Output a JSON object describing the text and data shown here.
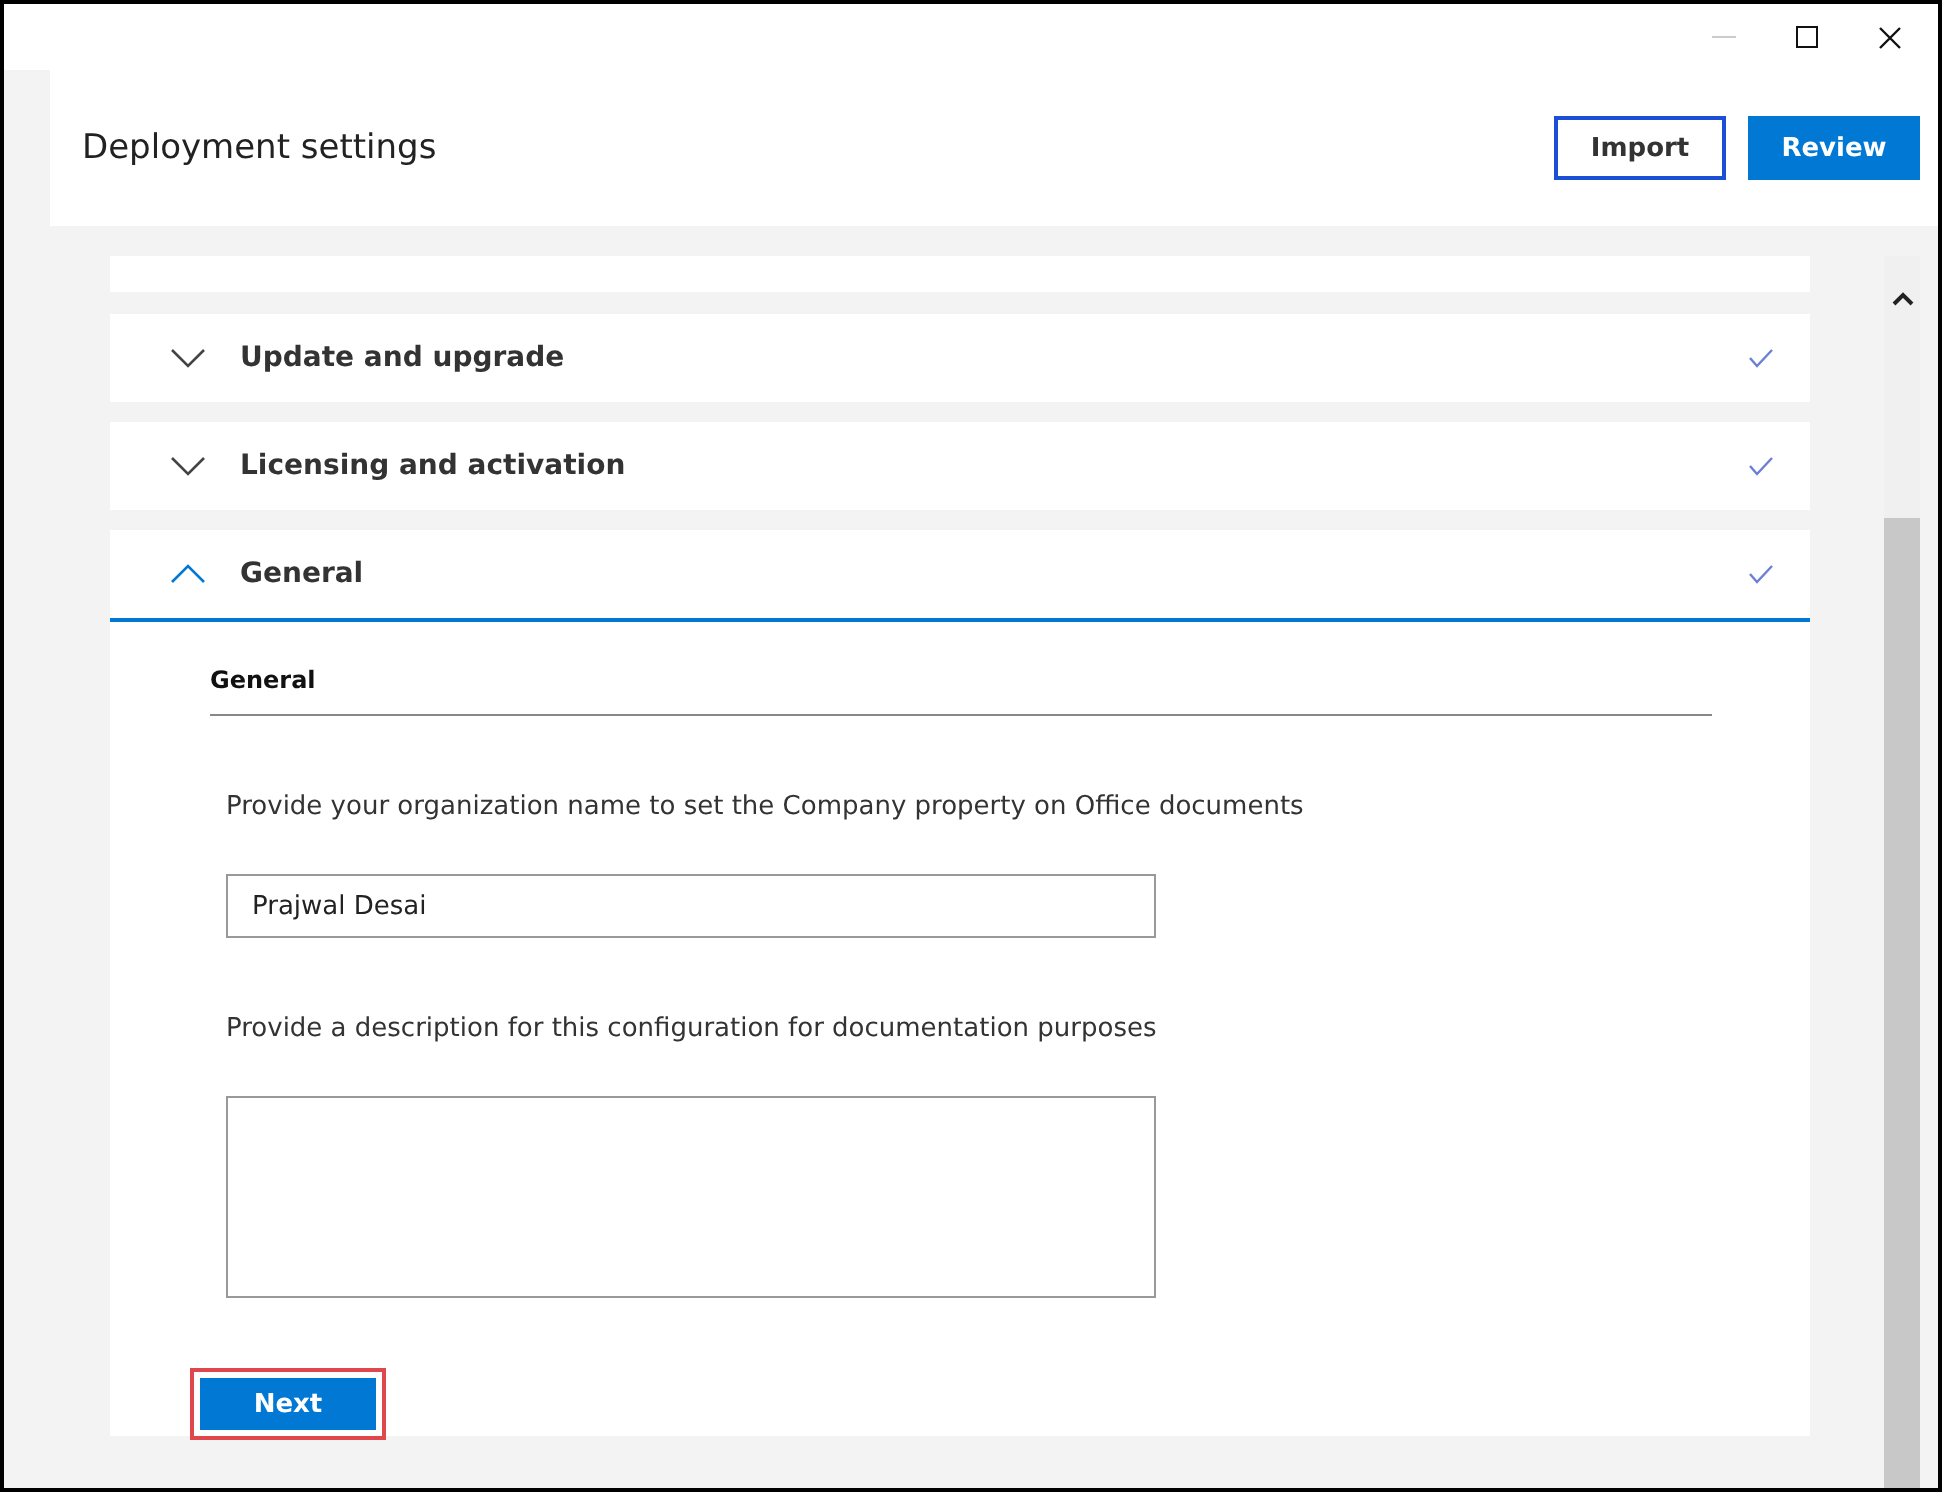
{
  "header": {
    "title": "Deployment settings",
    "buttons": [
      {
        "label": "Import",
        "kind": "secondary"
      },
      {
        "label": "Review",
        "kind": "primary"
      }
    ]
  },
  "sections": [
    {
      "title": "Update and upgrade",
      "expanded": false,
      "complete": true
    },
    {
      "title": "Licensing and activation",
      "expanded": false,
      "complete": true
    },
    {
      "title": "General",
      "expanded": true,
      "complete": true
    }
  ],
  "general": {
    "heading": "General",
    "fields": [
      {
        "kind": "text",
        "label": "Provide your organization name to set the Company property on Office documents",
        "value": "Prajwal Desai"
      },
      {
        "kind": "textarea",
        "label": "Provide a description for this configuration for documentation purposes"
      }
    ],
    "next_button": {
      "label": "Next",
      "highlighted": true
    }
  }
}
